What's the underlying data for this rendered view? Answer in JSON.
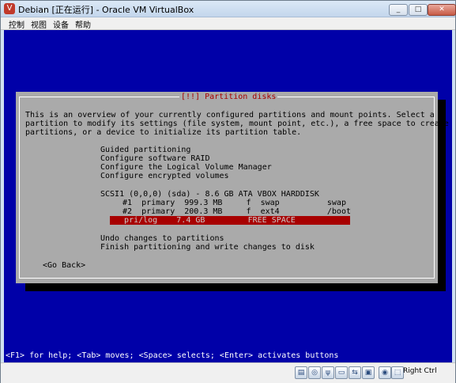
{
  "window": {
    "title": "Debian [正在运行] - Oracle VM VirtualBox",
    "controls": {
      "minimize": "_",
      "maximize": "□",
      "close": "✕"
    }
  },
  "menu": [
    "控制",
    "视图",
    "设备",
    "帮助"
  ],
  "dialog": {
    "title": "[!!] Partition disks",
    "intro": [
      "This is an overview of your currently configured partitions and mount points. Select a",
      "partition to modify its settings (file system, mount point, etc.), a free space to create",
      "partitions, or a device to initialize its partition table."
    ],
    "options": [
      "Guided partitioning",
      "Configure software RAID",
      "Configure the Logical Volume Manager",
      "Configure encrypted volumes"
    ],
    "disk": "SCSI1 (0,0,0) (sda) - 8.6 GB ATA VBOX HARDDISK",
    "partitions": [
      "#1  primary  999.3 MB     f  swap          swap",
      "#2  primary  200.3 MB     f  ext4          /boot"
    ],
    "selected_partition": "   pri/log    7.4 GB         FREE SPACE",
    "actions": [
      "Undo changes to partitions",
      "Finish partitioning and write changes to disk"
    ],
    "go_back": "<Go Back>"
  },
  "statusline": "<F1> for help; <Tab> moves; <Space> selects; <Enter> activates buttons",
  "vbox_status": {
    "icons": [
      "hdd-icon",
      "cd-icon",
      "usb-icon",
      "shared-folder-icon",
      "network-icon",
      "display-icon",
      "capture-icon",
      "mouse-icon"
    ],
    "host_key": "Right Ctrl"
  },
  "colors": {
    "screen_bg": "#0000a8",
    "dialog_bg": "#aaaaaa",
    "title_red": "#a80000",
    "selection_bg": "#a80000"
  }
}
